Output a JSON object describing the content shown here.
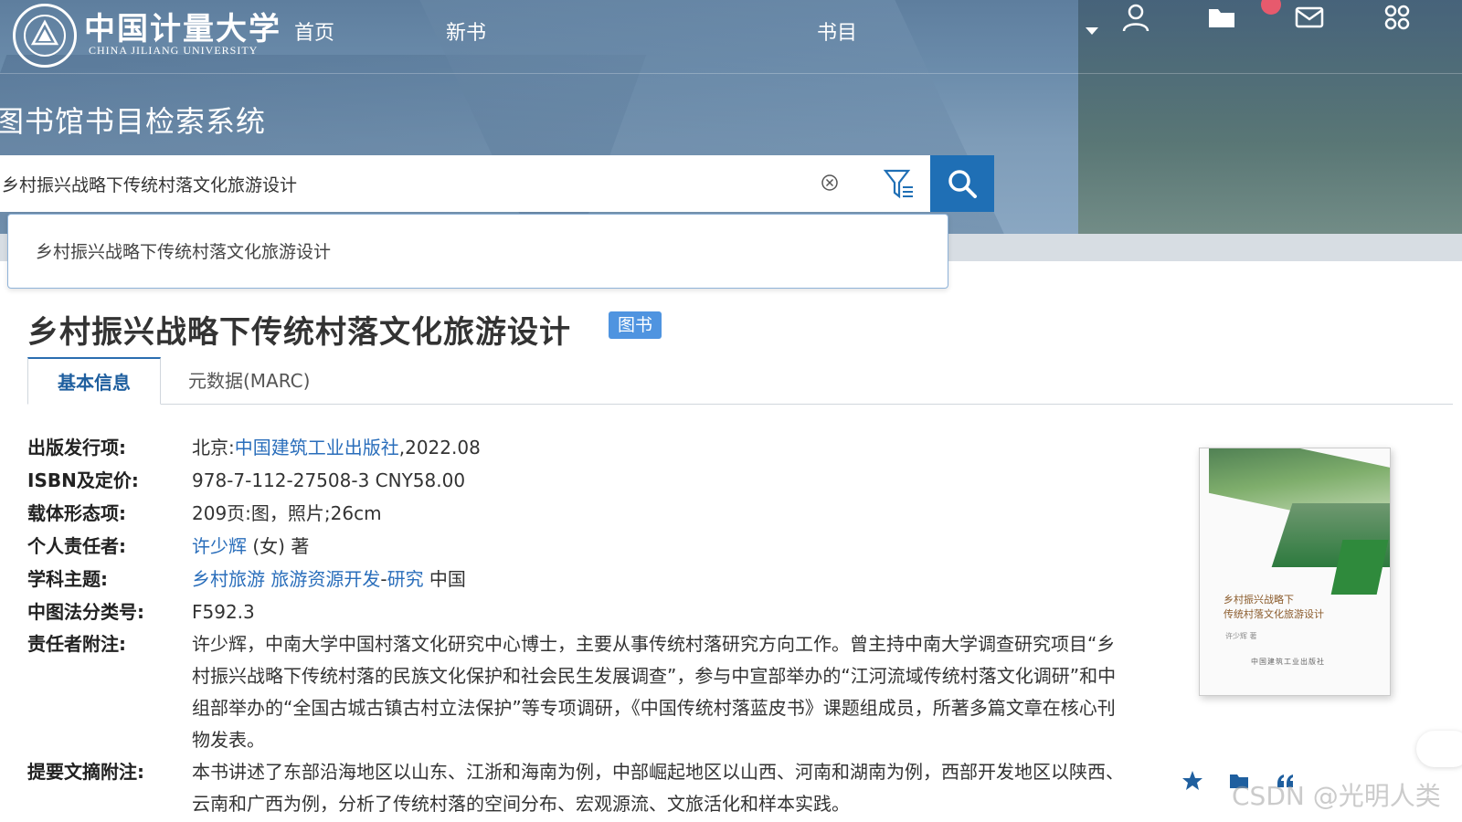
{
  "header": {
    "uni_name": "中国计量大学",
    "uni_en": "CHINA JILIANG UNIVERSITY",
    "nav": {
      "home": "首页",
      "new_books": "新书",
      "catalog": "书目"
    },
    "system_title": "图书馆书目检索系统"
  },
  "search": {
    "query": "乡村振兴战略下传统村落文化旅游设计",
    "suggestion": "乡村振兴战略下传统村落文化旅游设计"
  },
  "book": {
    "title": "乡村振兴战略下传统村落文化旅游设计",
    "type_badge": "图书",
    "tabs": {
      "basic": "基本信息",
      "marc": "元数据(MARC)"
    },
    "fields": {
      "publication": {
        "label": "出版发行项:",
        "prefix": "北京:",
        "publisher": "中国建筑工业出版社",
        "suffix": ",2022.08"
      },
      "isbn": {
        "label": "ISBN及定价:",
        "value": "978-7-112-27508-3 CNY58.00"
      },
      "physical": {
        "label": "载体形态项:",
        "value": "209页:图，照片;26cm"
      },
      "author": {
        "label": "个人责任者:",
        "name": "许少辉",
        "suffix": " (女) 著"
      },
      "subject": {
        "label": "学科主题:",
        "s1": "乡村旅游",
        "s2": "旅游资源开发",
        "sep": "-",
        "s3": "研究",
        "tail": " 中国"
      },
      "classification": {
        "label": "中图法分类号:",
        "value": "F592.3"
      },
      "author_note": {
        "label": "责任者附注:",
        "value": "许少辉，中南大学中国村落文化研究中心博士，主要从事传统村落研究方向工作。曾主持中南大学调查研究项目“乡村振兴战略下传统村落的民族文化保护和社会民生发展调查”，参与中宣部举办的“江河流域传统村落文化调研”和中组部举办的“全国古城古镇古村立法保护”等专项调研，《中国传统村落蓝皮书》课题组成员，所著多篇文章在核心刊物发表。"
      },
      "abstract": {
        "label": "提要文摘附注:",
        "value": "本书讲述了东部沿海地区以山东、江浙和海南为例，中部崛起地区以山西、河南和湖南为例，西部开发地区以陕西、云南和广西为例，分析了传统村落的空间分布、宏观源流、文旅活化和样本实践。"
      }
    },
    "cover": {
      "title_line1": "乡村振兴战略下",
      "title_line2": "传统村落文化旅游设计",
      "author": "许少辉 著",
      "publisher": "中国建筑工业出版社"
    }
  },
  "watermark": "CSDN @光明人类",
  "colors": {
    "accent": "#1f6fb5",
    "link": "#2a6ebb",
    "badge": "#4f94e0",
    "notification": "#e75a6d"
  }
}
